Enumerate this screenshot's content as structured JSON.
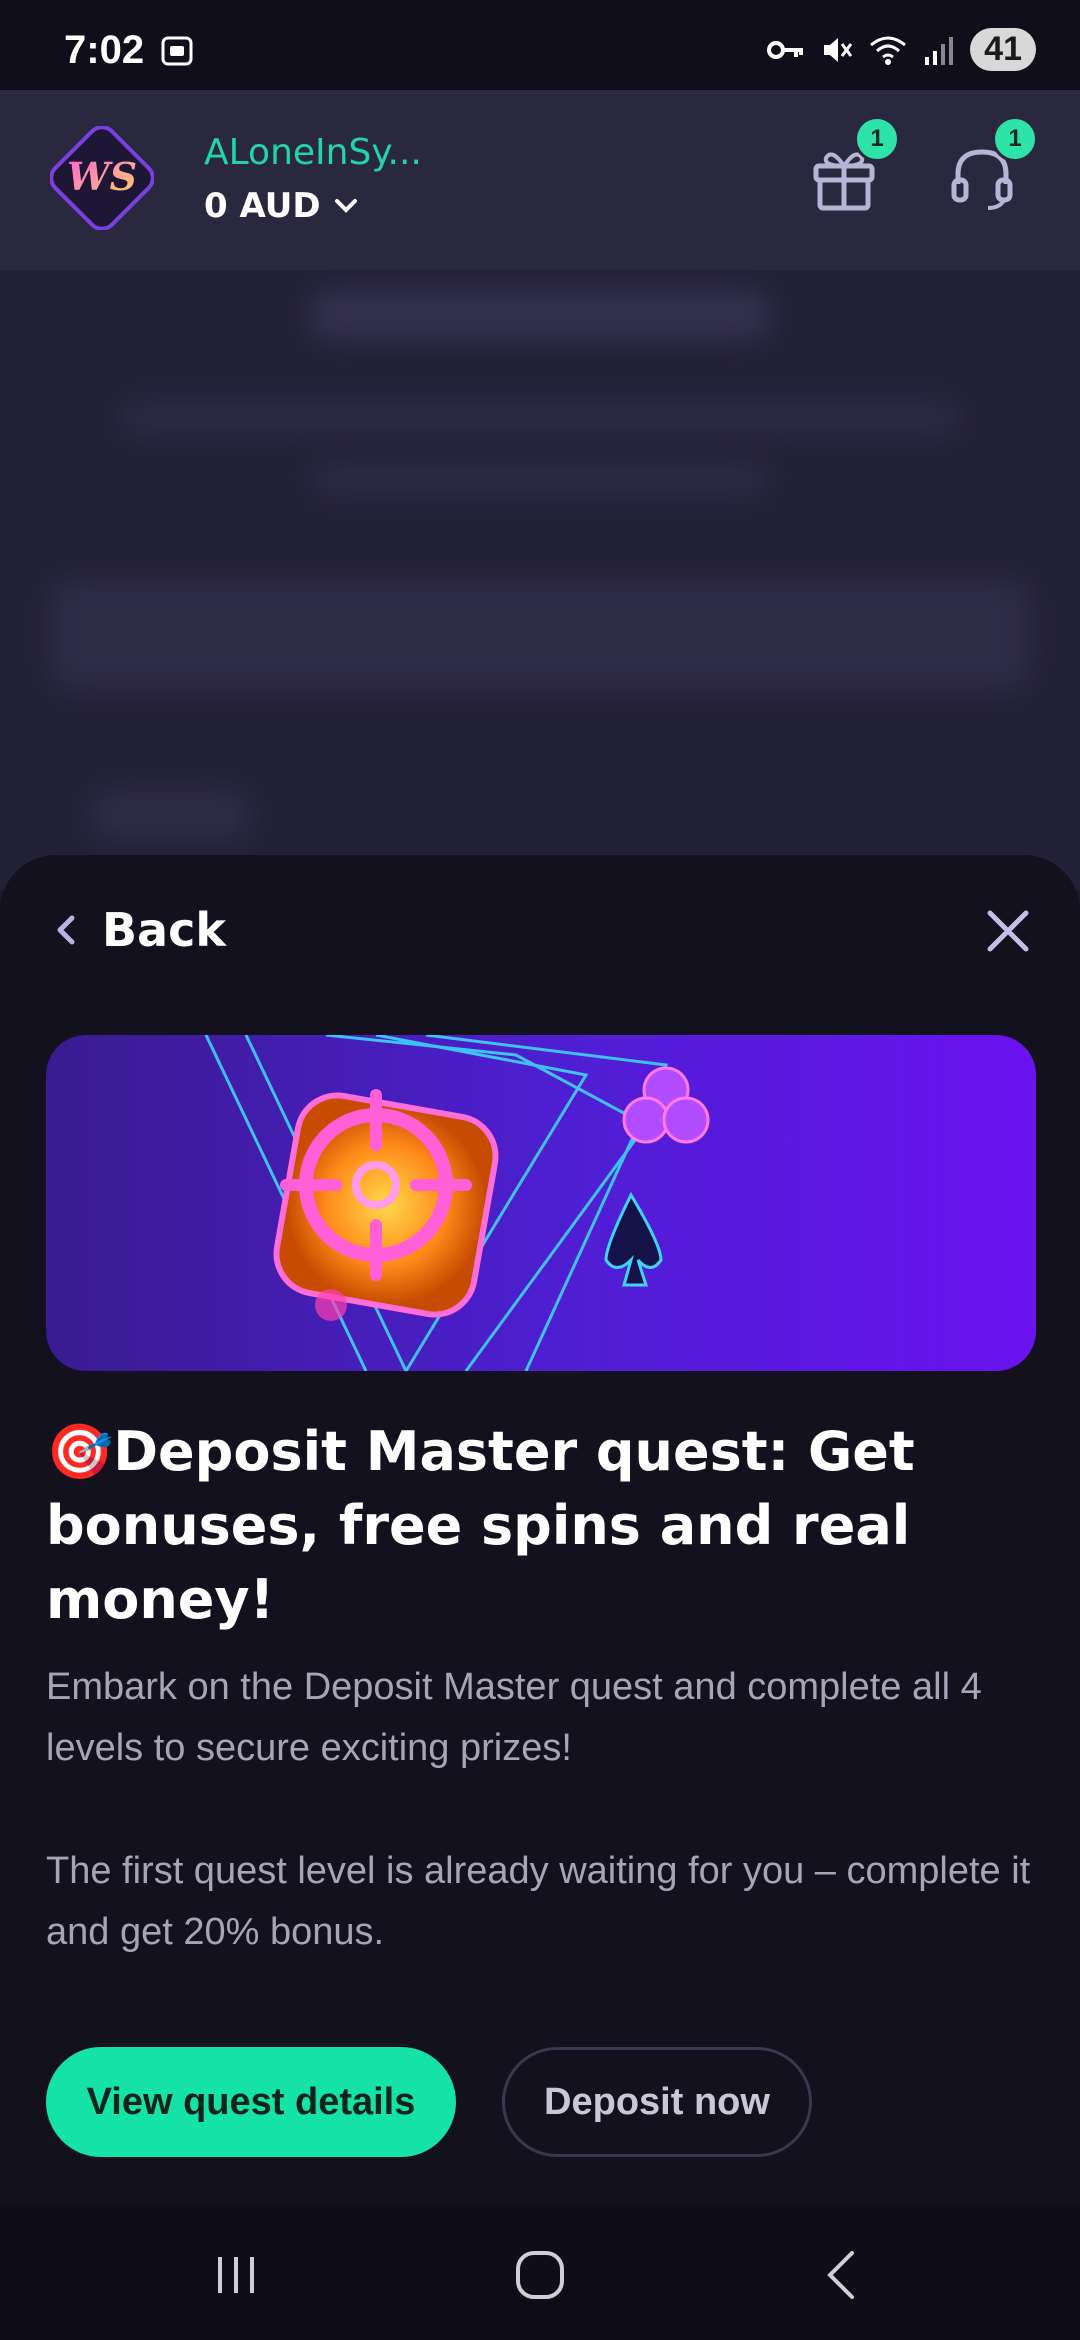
{
  "status_bar": {
    "time": "7:02",
    "battery": "41",
    "icons": [
      "screenshot-icon",
      "key-icon",
      "mute-icon",
      "wifi-icon",
      "signal-icon"
    ]
  },
  "header": {
    "username": "ALoneInSy...",
    "balance": "0 AUD",
    "gift_badge": "1",
    "support_badge": "1",
    "accent_color": "#23d5a6"
  },
  "sheet": {
    "back_label": "Back",
    "headline": "🎯Deposit Master quest: Get bonuses, free spins and real money!",
    "paragraph1": "Embark on the Deposit Master quest and complete all 4 levels to secure exciting prizes!",
    "paragraph2": "The first quest level is already waiting for you – complete it and get 20% bonus.",
    "primary_button": "View quest details",
    "secondary_button": "Deposit now",
    "primary_color": "#15e2a5"
  }
}
